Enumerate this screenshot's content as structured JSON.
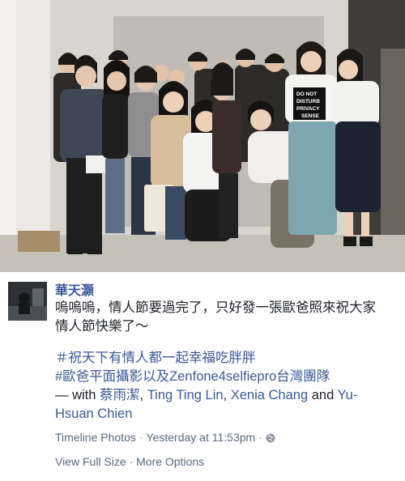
{
  "post": {
    "author": "華天灝",
    "message_lines": [
      "嗚嗚嗚，情人節要過完了，只好發一張歐爸照來祝大家",
      "情人節快樂了～"
    ],
    "hashtag_line1": "＃祝天下有情人都一起幸福吃胖胖",
    "hashtag_line2": "#歐爸平面攝影以及Zenfone4selfiepro台灣團隊",
    "with_prefix": " —  with ",
    "tagged": [
      "蔡雨潔",
      "Ting Ting Lin",
      "Xenia Chang",
      "Yu-Hsuan Chien"
    ],
    "tag_sep_1": ", ",
    "tag_sep_2": ", ",
    "tag_and": " and ",
    "tagged_last_part1": "Yu-",
    "tagged_last_part2": "Hsuan Chien",
    "album": "Timeline Photos",
    "dot": "·",
    "time": "Yesterday at 11:53pm",
    "privacy_icon": "globe-icon",
    "view_full_size": "View Full Size",
    "more_options": "More Options"
  },
  "photo": {
    "shirt_text": [
      "DO NOT",
      "DISTURB",
      "PRIVACY",
      "SENSE"
    ]
  },
  "colors": {
    "link": "#3b5998",
    "text": "#1d2129",
    "meta": "#5a6a80"
  }
}
